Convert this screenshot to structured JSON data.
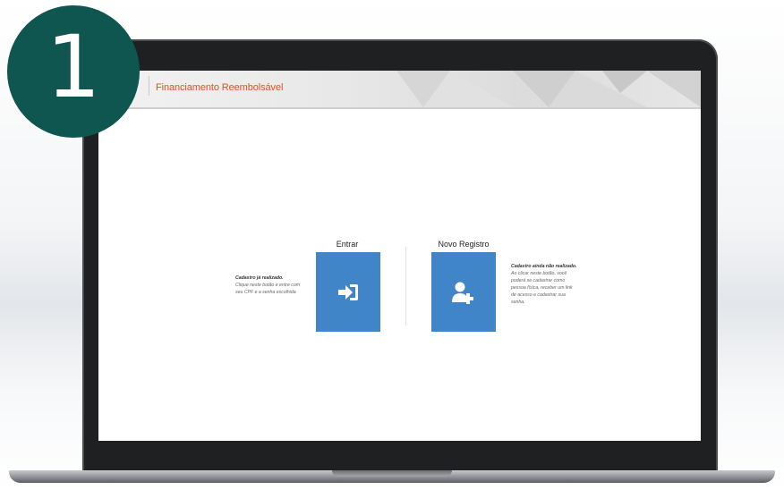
{
  "header": {
    "title": "Financiamento Reembolsável"
  },
  "login": {
    "label": "Entrar",
    "desc_title": "Cadastro já realizado.",
    "desc_lines": [
      "Clique neste botão e entre com",
      "seu CPF e a senha escolhida"
    ],
    "icon": "sign-in-icon"
  },
  "register": {
    "label": "Novo Registro",
    "desc_title": "Cadastro ainda não realizado.",
    "desc_lines": [
      "Ao clicar neste botão, você",
      "poderá se cadastrar como",
      "pessoa física, receber um link",
      "de acesso e cadastrar sua",
      "senha."
    ],
    "icon": "add-user-icon"
  },
  "badge": {
    "number": "1"
  },
  "colors": {
    "tile": "#3f85c7",
    "title": "#e0511f",
    "badge": "#0f5550",
    "bezel": "#1f2022"
  }
}
